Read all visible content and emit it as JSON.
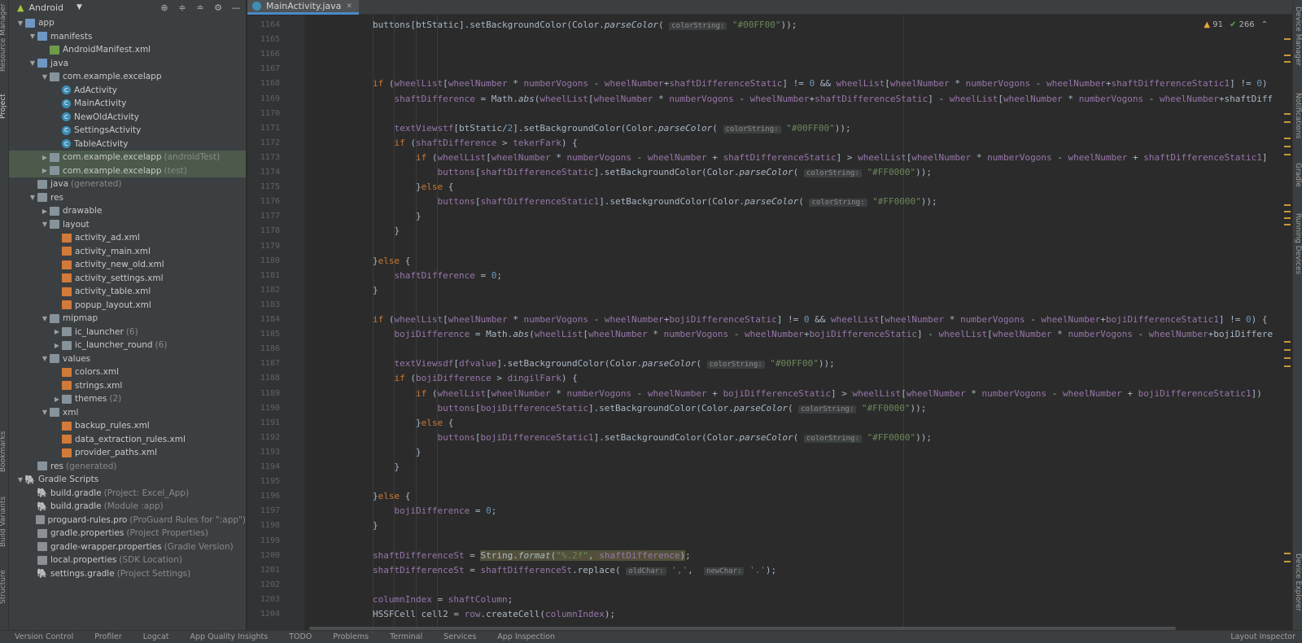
{
  "left_strip": {
    "labels": [
      "Resource Manager",
      "Project",
      "Bookmarks",
      "Build Variants",
      "Structure"
    ]
  },
  "right_strip": {
    "labels": [
      "Device Manager",
      "Notifications",
      "Gradle",
      "Running Devices",
      "Device Explorer"
    ]
  },
  "project": {
    "view_mode": "Android",
    "tree": [
      {
        "depth": 0,
        "arrow": "open",
        "icon": "folder-blue",
        "label": "app",
        "extra": ""
      },
      {
        "depth": 1,
        "arrow": "open",
        "icon": "folder-blue",
        "label": "manifests",
        "extra": ""
      },
      {
        "depth": 2,
        "arrow": "",
        "icon": "manifest",
        "label": "AndroidManifest.xml",
        "extra": ""
      },
      {
        "depth": 1,
        "arrow": "open",
        "icon": "folder-blue",
        "label": "java",
        "extra": ""
      },
      {
        "depth": 2,
        "arrow": "open",
        "icon": "folder",
        "label": "com.example.excelapp",
        "extra": ""
      },
      {
        "depth": 3,
        "arrow": "",
        "icon": "class",
        "label": "AdActivity",
        "extra": ""
      },
      {
        "depth": 3,
        "arrow": "",
        "icon": "class",
        "label": "MainActivity",
        "extra": ""
      },
      {
        "depth": 3,
        "arrow": "",
        "icon": "class",
        "label": "NewOldActivity",
        "extra": ""
      },
      {
        "depth": 3,
        "arrow": "",
        "icon": "class",
        "label": "SettingsActivity",
        "extra": ""
      },
      {
        "depth": 3,
        "arrow": "",
        "icon": "class",
        "label": "TableActivity",
        "extra": ""
      },
      {
        "depth": 2,
        "arrow": "closed",
        "icon": "folder",
        "label": "com.example.excelapp",
        "extra": "(androidTest)",
        "selected": true
      },
      {
        "depth": 2,
        "arrow": "closed",
        "icon": "folder",
        "label": "com.example.excelapp",
        "extra": "(test)",
        "selected": true
      },
      {
        "depth": 1,
        "arrow": "",
        "icon": "folder",
        "label": "java",
        "extra": "(generated)"
      },
      {
        "depth": 1,
        "arrow": "open",
        "icon": "folder",
        "label": "res",
        "extra": ""
      },
      {
        "depth": 2,
        "arrow": "closed",
        "icon": "folder",
        "label": "drawable",
        "extra": ""
      },
      {
        "depth": 2,
        "arrow": "open",
        "icon": "folder",
        "label": "layout",
        "extra": ""
      },
      {
        "depth": 3,
        "arrow": "",
        "icon": "xml",
        "label": "activity_ad.xml",
        "extra": ""
      },
      {
        "depth": 3,
        "arrow": "",
        "icon": "xml",
        "label": "activity_main.xml",
        "extra": ""
      },
      {
        "depth": 3,
        "arrow": "",
        "icon": "xml",
        "label": "activity_new_old.xml",
        "extra": ""
      },
      {
        "depth": 3,
        "arrow": "",
        "icon": "xml",
        "label": "activity_settings.xml",
        "extra": ""
      },
      {
        "depth": 3,
        "arrow": "",
        "icon": "xml",
        "label": "activity_table.xml",
        "extra": ""
      },
      {
        "depth": 3,
        "arrow": "",
        "icon": "xml",
        "label": "popup_layout.xml",
        "extra": ""
      },
      {
        "depth": 2,
        "arrow": "open",
        "icon": "folder",
        "label": "mipmap",
        "extra": ""
      },
      {
        "depth": 3,
        "arrow": "closed",
        "icon": "folder",
        "label": "ic_launcher",
        "extra": "(6)"
      },
      {
        "depth": 3,
        "arrow": "closed",
        "icon": "folder",
        "label": "ic_launcher_round",
        "extra": "(6)"
      },
      {
        "depth": 2,
        "arrow": "open",
        "icon": "folder",
        "label": "values",
        "extra": ""
      },
      {
        "depth": 3,
        "arrow": "",
        "icon": "xml",
        "label": "colors.xml",
        "extra": ""
      },
      {
        "depth": 3,
        "arrow": "",
        "icon": "xml",
        "label": "strings.xml",
        "extra": ""
      },
      {
        "depth": 3,
        "arrow": "closed",
        "icon": "folder",
        "label": "themes",
        "extra": "(2)"
      },
      {
        "depth": 2,
        "arrow": "open",
        "icon": "folder",
        "label": "xml",
        "extra": ""
      },
      {
        "depth": 3,
        "arrow": "",
        "icon": "xml",
        "label": "backup_rules.xml",
        "extra": ""
      },
      {
        "depth": 3,
        "arrow": "",
        "icon": "xml",
        "label": "data_extraction_rules.xml",
        "extra": ""
      },
      {
        "depth": 3,
        "arrow": "",
        "icon": "xml",
        "label": "provider_paths.xml",
        "extra": ""
      },
      {
        "depth": 1,
        "arrow": "",
        "icon": "folder",
        "label": "res",
        "extra": "(generated)"
      },
      {
        "depth": 0,
        "arrow": "open",
        "icon": "gradle",
        "label": "Gradle Scripts",
        "extra": ""
      },
      {
        "depth": 1,
        "arrow": "",
        "icon": "gradle",
        "label": "build.gradle",
        "extra": "(Project: Excel_App)"
      },
      {
        "depth": 1,
        "arrow": "",
        "icon": "gradle",
        "label": "build.gradle",
        "extra": "(Module :app)"
      },
      {
        "depth": 1,
        "arrow": "",
        "icon": "props",
        "label": "proguard-rules.pro",
        "extra": "(ProGuard Rules for \":app\")"
      },
      {
        "depth": 1,
        "arrow": "",
        "icon": "props",
        "label": "gradle.properties",
        "extra": "(Project Properties)"
      },
      {
        "depth": 1,
        "arrow": "",
        "icon": "props",
        "label": "gradle-wrapper.properties",
        "extra": "(Gradle Version)"
      },
      {
        "depth": 1,
        "arrow": "",
        "icon": "props",
        "label": "local.properties",
        "extra": "(SDK Location)"
      },
      {
        "depth": 1,
        "arrow": "",
        "icon": "gradle",
        "label": "settings.gradle",
        "extra": "(Project Settings)"
      }
    ]
  },
  "editor": {
    "tab_label": "MainActivity.java",
    "warnings": "91",
    "weak_warnings": "266",
    "lines": [
      {
        "n": "1164",
        "indent": 0,
        "html": "buttons[btStatic].setBackgroundColor(Color.<span class=\"it\">parseColor</span>( <span class=\"hint\">colorString:</span> <span class=\"str\">\"#00FF00\"</span>));"
      },
      {
        "n": "1165",
        "indent": 0,
        "html": ""
      },
      {
        "n": "1166",
        "indent": 0,
        "html": ""
      },
      {
        "n": "1167",
        "indent": 0,
        "html": ""
      },
      {
        "n": "1168",
        "indent": 0,
        "html": "<span class=\"kw\">if</span> (<span class=\"fld\">wheelList</span>[<span class=\"fld\">wheelNumber</span> * <span class=\"fld\">numberVogons</span> - <span class=\"fld\">wheelNumber</span>+<span class=\"fld\">shaftDifferenceStatic</span>] != <span class=\"num\">0</span> &amp;&amp; <span class=\"fld\">wheelList</span>[<span class=\"fld\">wheelNumber</span> * <span class=\"fld\">numberVogons</span> - <span class=\"fld\">wheelNumber</span>+<span class=\"fld\">shaftDifferenceStatic1</span>] != <span class=\"num\">0</span>)"
      },
      {
        "n": "1169",
        "indent": 1,
        "html": "<span class=\"fld\">shaftDifference</span> = Math.<span class=\"it\">abs</span>(<span class=\"fld\">wheelList</span>[<span class=\"fld\">wheelNumber</span> * <span class=\"fld\">numberVogons</span> - <span class=\"fld\">wheelNumber</span>+<span class=\"fld\">shaftDifferenceStatic</span>] - <span class=\"fld\">wheelList</span>[<span class=\"fld\">wheelNumber</span> * <span class=\"fld\">numberVogons</span> - <span class=\"fld\">wheelNumber</span>+shaftDiff"
      },
      {
        "n": "1170",
        "indent": 0,
        "html": ""
      },
      {
        "n": "1171",
        "indent": 1,
        "html": "<span class=\"fld\">textViewstf</span>[btStatic/<span class=\"num\">2</span>].setBackgroundColor(Color.<span class=\"it\">parseColor</span>( <span class=\"hint\">colorString:</span> <span class=\"str\">\"#00FF00\"</span>));"
      },
      {
        "n": "1172",
        "indent": 1,
        "html": "<span class=\"kw\">if</span> (<span class=\"fld\">shaftDifference</span> &gt; <span class=\"fld\">tekerFark</span>) {"
      },
      {
        "n": "1173",
        "indent": 2,
        "html": "<span class=\"kw\">if</span> (<span class=\"fld\">wheelList</span>[<span class=\"fld\">wheelNumber</span> * <span class=\"fld\">numberVogons</span> - <span class=\"fld\">wheelNumber</span> + <span class=\"fld\">shaftDifferenceStatic</span>] &gt; <span class=\"fld\">wheelList</span>[<span class=\"fld\">wheelNumber</span> * <span class=\"fld\">numberVogons</span> - <span class=\"fld\">wheelNumber</span> + <span class=\"fld\">shaftDifferenceStatic1</span>]"
      },
      {
        "n": "1174",
        "indent": 3,
        "html": "<span class=\"fld\">buttons</span>[<span class=\"fld\">shaftDifferenceStatic</span>].setBackgroundColor(Color.<span class=\"it\">parseColor</span>( <span class=\"hint\">colorString:</span> <span class=\"str\">\"#FF0000\"</span>));"
      },
      {
        "n": "1175",
        "indent": 2,
        "html": "}<span class=\"kw\">else</span> {"
      },
      {
        "n": "1176",
        "indent": 3,
        "html": "<span class=\"fld\">buttons</span>[<span class=\"fld\">shaftDifferenceStatic1</span>].setBackgroundColor(Color.<span class=\"it\">parseColor</span>( <span class=\"hint\">colorString:</span> <span class=\"str\">\"#FF0000\"</span>));"
      },
      {
        "n": "1177",
        "indent": 2,
        "html": "}"
      },
      {
        "n": "1178",
        "indent": 1,
        "html": "}"
      },
      {
        "n": "1179",
        "indent": 0,
        "html": ""
      },
      {
        "n": "1180",
        "indent": 0,
        "html": "}<span class=\"kw\">else</span> {"
      },
      {
        "n": "1181",
        "indent": 1,
        "html": "<span class=\"fld\">shaftDifference</span> = <span class=\"num\">0</span>;"
      },
      {
        "n": "1182",
        "indent": 0,
        "html": "}"
      },
      {
        "n": "1183",
        "indent": 0,
        "html": ""
      },
      {
        "n": "1184",
        "indent": 0,
        "html": "<span class=\"kw\">if</span> (<span class=\"fld\">wheelList</span>[<span class=\"fld\">wheelNumber</span> * <span class=\"fld\">numberVogons</span> - <span class=\"fld\">wheelNumber</span>+<span class=\"fld\">bojiDifferenceStatic</span>] != <span class=\"num\">0</span> &amp;&amp; <span class=\"fld\">wheelList</span>[<span class=\"fld\">wheelNumber</span> * <span class=\"fld\">numberVogons</span> - <span class=\"fld\">wheelNumber</span>+<span class=\"fld\">bojiDifferenceStatic1</span>] != <span class=\"num\">0</span>) {"
      },
      {
        "n": "1185",
        "indent": 1,
        "html": "<span class=\"fld\">bojiDifference</span> = Math.<span class=\"it\">abs</span>(<span class=\"fld\">wheelList</span>[<span class=\"fld\">wheelNumber</span> * <span class=\"fld\">numberVogons</span> - <span class=\"fld\">wheelNumber</span>+<span class=\"fld\">bojiDifferenceStatic</span>] - <span class=\"fld\">wheelList</span>[<span class=\"fld\">wheelNumber</span> * <span class=\"fld\">numberVogons</span> - <span class=\"fld\">wheelNumber</span>+bojiDiffere"
      },
      {
        "n": "1186",
        "indent": 0,
        "html": ""
      },
      {
        "n": "1187",
        "indent": 1,
        "html": "<span class=\"fld\">textViewsdf</span>[<span class=\"fld\">dfvalue</span>].setBackgroundColor(Color.<span class=\"it\">parseColor</span>( <span class=\"hint\">colorString:</span> <span class=\"str\">\"#00FF00\"</span>));"
      },
      {
        "n": "1188",
        "indent": 1,
        "html": "<span class=\"kw\">if</span> (<span class=\"fld\">bojiDifference</span> &gt; <span class=\"fld\">dingilFark</span>) {"
      },
      {
        "n": "1189",
        "indent": 2,
        "html": "<span class=\"kw\">if</span> (<span class=\"fld\">wheelList</span>[<span class=\"fld\">wheelNumber</span> * <span class=\"fld\">numberVogons</span> - <span class=\"fld\">wheelNumber</span> + <span class=\"fld\">bojiDifferenceStatic</span>] &gt; <span class=\"fld\">wheelList</span>[<span class=\"fld\">wheelNumber</span> * <span class=\"fld\">numberVogons</span> - <span class=\"fld\">wheelNumber</span> + <span class=\"fld\">bojiDifferenceStatic1</span>])"
      },
      {
        "n": "1190",
        "indent": 3,
        "html": "<span class=\"fld\">buttons</span>[<span class=\"fld\">bojiDifferenceStatic</span>].setBackgroundColor(Color.<span class=\"it\">parseColor</span>( <span class=\"hint\">colorString:</span> <span class=\"str\">\"#FF0000\"</span>));"
      },
      {
        "n": "1191",
        "indent": 2,
        "html": "}<span class=\"kw\">else</span> {"
      },
      {
        "n": "1192",
        "indent": 3,
        "html": "<span class=\"fld\">buttons</span>[<span class=\"fld\">bojiDifferenceStatic1</span>].setBackgroundColor(Color.<span class=\"it\">parseColor</span>( <span class=\"hint\">colorString:</span> <span class=\"str\">\"#FF0000\"</span>));"
      },
      {
        "n": "1193",
        "indent": 2,
        "html": "}"
      },
      {
        "n": "1194",
        "indent": 1,
        "html": "}"
      },
      {
        "n": "1195",
        "indent": 0,
        "html": ""
      },
      {
        "n": "1196",
        "indent": 0,
        "html": "}<span class=\"kw\">else</span> {"
      },
      {
        "n": "1197",
        "indent": 1,
        "html": "<span class=\"fld\">bojiDifference</span> = <span class=\"num\">0</span>;"
      },
      {
        "n": "1198",
        "indent": 0,
        "html": "}"
      },
      {
        "n": "1199",
        "indent": 0,
        "html": ""
      },
      {
        "n": "1200",
        "indent": 0,
        "html": "<span class=\"fld\">shaftDifferenceSt</span> = <span class=\"hl\">String.<span class=\"it\">format</span>(<span class=\"str\">\"%.2f\"</span>, <span class=\"fld\">shaftDifference</span>)</span>;"
      },
      {
        "n": "1201",
        "indent": 0,
        "html": "<span class=\"fld\">shaftDifferenceSt</span> = <span class=\"fld\">shaftDifferenceSt</span>.replace( <span class=\"hint\">oldChar:</span> <span class=\"str\">','</span>,  <span class=\"hint\">newChar:</span> <span class=\"str\">'.'</span>);"
      },
      {
        "n": "1202",
        "indent": 0,
        "html": ""
      },
      {
        "n": "1203",
        "indent": 0,
        "html": "<span class=\"fld\">columnIndex</span> = <span class=\"fld\">shaftColumn</span>;"
      },
      {
        "n": "1204",
        "indent": 0,
        "html": "HSSFCell cell2 = <span class=\"fld\">row</span>.createCell(<span class=\"fld\">columnIndex</span>);"
      }
    ]
  },
  "bottom_bar": {
    "items": [
      "Version Control",
      "Profiler",
      "Logcat",
      "App Quality Insights",
      "TODO",
      "Problems",
      "Terminal",
      "Services",
      "App Inspection"
    ],
    "right": "Layout Inspector"
  }
}
